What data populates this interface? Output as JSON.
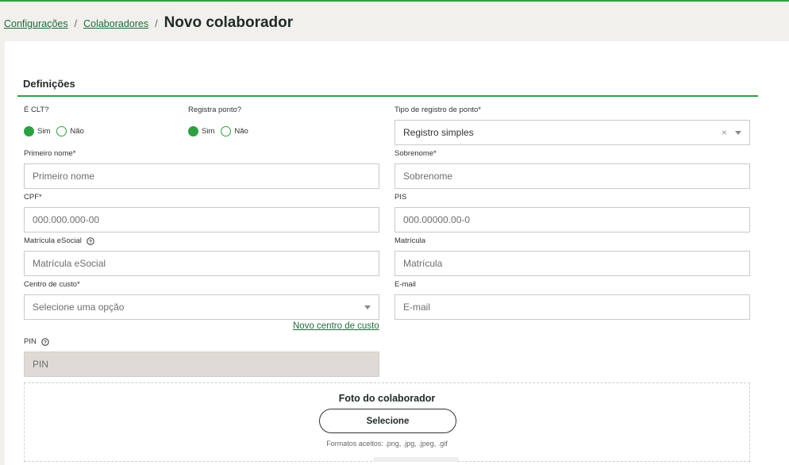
{
  "breadcrumb": {
    "items": [
      "Configurações",
      "Colaboradores"
    ],
    "separator": "/",
    "current": "Novo colaborador"
  },
  "section": {
    "title": "Definições"
  },
  "clt": {
    "label": "É CLT?",
    "options": [
      "Sim",
      "Não"
    ],
    "selected": "Sim"
  },
  "registra_ponto": {
    "label": "Registra ponto?",
    "options": [
      "Sim",
      "Não"
    ],
    "selected": "Sim"
  },
  "tipo_registro": {
    "label": "Tipo de registro de ponto*",
    "value": "Registro simples",
    "clear_glyph": "×"
  },
  "primeiro_nome": {
    "label": "Primeiro nome*",
    "placeholder": "Primeiro nome"
  },
  "sobrenome": {
    "label": "Sobrenome*",
    "placeholder": "Sobrenome"
  },
  "cpf": {
    "label": "CPF*",
    "placeholder": "000.000.000-00"
  },
  "pis": {
    "label": "PIS",
    "placeholder": "000.00000.00-0"
  },
  "matricula_esocial": {
    "label": "Matrícula eSocial",
    "placeholder": "Matrícula eSocial",
    "icon": "help-circle-icon"
  },
  "matricula": {
    "label": "Matrícula",
    "placeholder": "Matrícula"
  },
  "centro_custo": {
    "label": "Centro de custo*",
    "placeholder": "Selecione uma opção",
    "new_link": "Novo centro de custo"
  },
  "email": {
    "label": "E-mail",
    "placeholder": "E-mail"
  },
  "pin": {
    "label": "PIN",
    "placeholder": "PIN",
    "icon": "help-circle-icon"
  },
  "photo": {
    "title": "Foto do colaborador",
    "button": "Selecione",
    "hint": "Formatos aceitos: .png, .jpg, .jpeg, .gif"
  },
  "colors": {
    "accent": "#2ea043",
    "link": "#1f6b3a",
    "header_bg": "#f1f0ed"
  }
}
